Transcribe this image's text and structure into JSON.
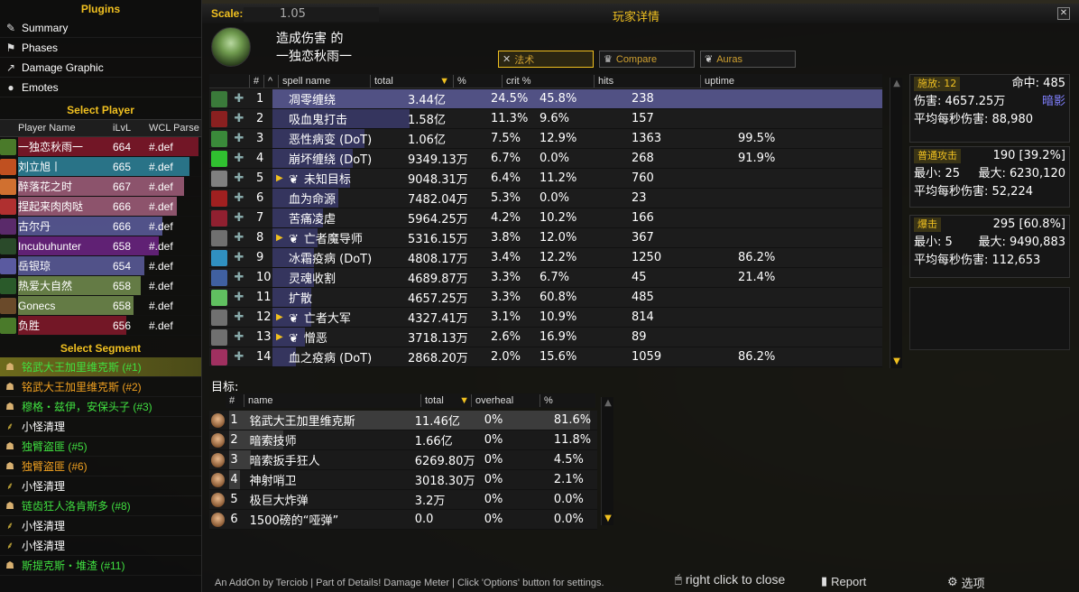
{
  "plugins": {
    "title": "Plugins",
    "items": [
      {
        "label": "Summary",
        "icon": "scroll-icon"
      },
      {
        "label": "Phases",
        "icon": "phases-icon"
      },
      {
        "label": "Damage Graphic",
        "icon": "graph-icon"
      },
      {
        "label": "Emotes",
        "icon": "chat-icon"
      }
    ]
  },
  "players": {
    "title": "Select Player",
    "columns": [
      "Player Name",
      "iLvL",
      "WCL Parse"
    ],
    "rows": [
      {
        "name": "一独恋秋雨一",
        "ilvl": "664",
        "wcl": "#.def",
        "color": "#c41e3a",
        "bar": 1.0,
        "icon": "#4a7a2a"
      },
      {
        "name": "刘立旭丨",
        "ilvl": "665",
        "wcl": "#.def",
        "color": "#3fc7eb",
        "bar": 0.95,
        "icon": "#c05020"
      },
      {
        "name": "醉落花之时",
        "ilvl": "667",
        "wcl": "#.def",
        "color": "#f48cba",
        "bar": 0.92,
        "icon": "#d07030"
      },
      {
        "name": "捏起来肉肉哒",
        "ilvl": "666",
        "wcl": "#.def",
        "color": "#f48cba",
        "bar": 0.88,
        "icon": "#b03030"
      },
      {
        "name": "古尔丹",
        "ilvl": "666",
        "wcl": "#.def",
        "color": "#8788ee",
        "bar": 0.8,
        "icon": "#5a2a6a"
      },
      {
        "name": "Incubuhunter",
        "ilvl": "658",
        "wcl": "#.def",
        "color": "#a330c9",
        "bar": 0.78,
        "icon": "#2a4a2a"
      },
      {
        "name": "岳银琼",
        "ilvl": "654",
        "wcl": "#.def",
        "color": "#8788ee",
        "bar": 0.7,
        "icon": "#5a5aa0"
      },
      {
        "name": "热爱大自然",
        "ilvl": "658",
        "wcl": "#.def",
        "color": "#aad372",
        "bar": 0.68,
        "icon": "#2a5a2a"
      },
      {
        "name": "Gonecs",
        "ilvl": "658",
        "wcl": "#.def",
        "color": "#aad372",
        "bar": 0.64,
        "icon": "#6a4a2a"
      },
      {
        "name": "负胜",
        "ilvl": "656",
        "wcl": "#.def",
        "color": "#c41e3a",
        "bar": 0.6,
        "icon": "#4a7a2a"
      }
    ]
  },
  "segments": {
    "title": "Select Segment",
    "items": [
      {
        "label": "铭武大王加里维克斯 (#1)",
        "color": "#40e040",
        "selected": true,
        "icon": "skull"
      },
      {
        "label": "铭武大王加里维克斯 (#2)",
        "color": "#f0a020",
        "selected": false,
        "icon": "skull"
      },
      {
        "label": "穆格・兹伊，安保头子 (#3)",
        "color": "#40e040",
        "selected": false,
        "icon": "skull"
      },
      {
        "label": "小怪清理",
        "color": "#ffffff",
        "selected": false,
        "icon": "broom"
      },
      {
        "label": "独臂盗匪 (#5)",
        "color": "#40e040",
        "selected": false,
        "icon": "skull"
      },
      {
        "label": "独臂盗匪 (#6)",
        "color": "#f0a020",
        "selected": false,
        "icon": "skull"
      },
      {
        "label": "小怪清理",
        "color": "#ffffff",
        "selected": false,
        "icon": "broom"
      },
      {
        "label": "链齿狂人洛肯斯多 (#8)",
        "color": "#40e040",
        "selected": false,
        "icon": "skull"
      },
      {
        "label": "小怪清理",
        "color": "#ffffff",
        "selected": false,
        "icon": "broom"
      },
      {
        "label": "小怪清理",
        "color": "#ffffff",
        "selected": false,
        "icon": "broom"
      },
      {
        "label": "斯提克斯・堆渣 (#11)",
        "color": "#40e040",
        "selected": false,
        "icon": "skull"
      }
    ]
  },
  "window": {
    "scale_label": "Scale:",
    "scale_value": "1.05",
    "title": "玩家详情",
    "close": "✕"
  },
  "header": {
    "line1": "造成伤害 的",
    "line2": "一独恋秋雨一"
  },
  "tabs": [
    {
      "label": "法术",
      "icon": "sword-icon",
      "active": true
    },
    {
      "label": "Compare",
      "icon": "crown-icon",
      "active": false
    },
    {
      "label": "Auras",
      "icon": "paw-icon",
      "active": false
    }
  ],
  "spells": {
    "columns": [
      "#",
      "^",
      "spell name",
      "total",
      "%",
      "crit %",
      "hits",
      "uptime"
    ],
    "rows": [
      {
        "idx": "1",
        "name": "凋零缠绕",
        "total": "3.44亿",
        "pct": "24.5%",
        "crit": "45.8%",
        "hits": "238",
        "uptime": "",
        "bar": 1.0,
        "pet": false,
        "icon": "#3a7a3a"
      },
      {
        "idx": "2",
        "name": "吸血鬼打击",
        "total": "1.58亿",
        "pct": "11.3%",
        "crit": "9.6%",
        "hits": "157",
        "uptime": "",
        "bar": 0.46,
        "pet": false,
        "icon": "#8a2020"
      },
      {
        "idx": "3",
        "name": "恶性病变 (DoT)",
        "total": "1.06亿",
        "pct": "7.5%",
        "crit": "12.9%",
        "hits": "1363",
        "uptime": "99.5%",
        "bar": 0.31,
        "pet": false,
        "icon": "#3a8a3a"
      },
      {
        "idx": "4",
        "name": "崩坏缠绕 (DoT)",
        "total": "9349.13万",
        "pct": "6.7%",
        "crit": "0.0%",
        "hits": "268",
        "uptime": "91.9%",
        "bar": 0.27,
        "pet": false,
        "icon": "#30c030"
      },
      {
        "idx": "5",
        "name": "未知目标",
        "total": "9048.31万",
        "pct": "6.4%",
        "crit": "11.2%",
        "hits": "760",
        "uptime": "",
        "bar": 0.26,
        "pet": true,
        "icon": "#808080"
      },
      {
        "idx": "6",
        "name": "血为命源",
        "total": "7482.04万",
        "pct": "5.3%",
        "crit": "0.0%",
        "hits": "23",
        "uptime": "",
        "bar": 0.22,
        "pet": false,
        "icon": "#a02020"
      },
      {
        "idx": "7",
        "name": "苦痛凌虐",
        "total": "5964.25万",
        "pct": "4.2%",
        "crit": "10.2%",
        "hits": "166",
        "uptime": "",
        "bar": 0.17,
        "pet": false,
        "icon": "#902030"
      },
      {
        "idx": "8",
        "name": "亡者魔导师",
        "total": "5316.15万",
        "pct": "3.8%",
        "crit": "12.0%",
        "hits": "367",
        "uptime": "",
        "bar": 0.15,
        "pet": true,
        "icon": "#707070"
      },
      {
        "idx": "9",
        "name": "冰霜疫病 (DoT)",
        "total": "4808.17万",
        "pct": "3.4%",
        "crit": "12.2%",
        "hits": "1250",
        "uptime": "86.2%",
        "bar": 0.14,
        "pet": false,
        "icon": "#3090c0"
      },
      {
        "idx": "10",
        "name": "灵魂收割",
        "total": "4689.87万",
        "pct": "3.3%",
        "crit": "6.7%",
        "hits": "45",
        "uptime": "21.4%",
        "bar": 0.14,
        "pet": false,
        "icon": "#4060a0"
      },
      {
        "idx": "11",
        "name": "扩散",
        "total": "4657.25万",
        "pct": "3.3%",
        "crit": "60.8%",
        "hits": "485",
        "uptime": "",
        "bar": 0.13,
        "pet": false,
        "icon": "#60c060"
      },
      {
        "idx": "12",
        "name": "亡者大军",
        "total": "4327.41万",
        "pct": "3.1%",
        "crit": "10.9%",
        "hits": "814",
        "uptime": "",
        "bar": 0.13,
        "pet": true,
        "icon": "#707070"
      },
      {
        "idx": "13",
        "name": "憎恶",
        "total": "3718.13万",
        "pct": "2.6%",
        "crit": "16.9%",
        "hits": "89",
        "uptime": "",
        "bar": 0.11,
        "pet": true,
        "icon": "#707070"
      },
      {
        "idx": "14",
        "name": "血之疫病 (DoT)",
        "total": "2868.20万",
        "pct": "2.0%",
        "crit": "15.6%",
        "hits": "1059",
        "uptime": "86.2%",
        "bar": 0.08,
        "pet": false,
        "icon": "#a03060"
      }
    ]
  },
  "targets": {
    "label": "目标:",
    "columns": [
      "#",
      "name",
      "total",
      "overheal",
      "%"
    ],
    "rows": [
      {
        "idx": "1",
        "name": "铭武大王加里维克斯",
        "total": "11.46亿",
        "overheal": "0%",
        "pct": "81.6%",
        "bar": 1.0
      },
      {
        "idx": "2",
        "name": "暗索技师",
        "total": "1.66亿",
        "overheal": "0%",
        "pct": "11.8%",
        "bar": 0.15
      },
      {
        "idx": "3",
        "name": "暗索扳手狂人",
        "total": "6269.80万",
        "overheal": "0%",
        "pct": "4.5%",
        "bar": 0.06
      },
      {
        "idx": "4",
        "name": "神射哨卫",
        "total": "3018.30万",
        "overheal": "0%",
        "pct": "2.1%",
        "bar": 0.03
      },
      {
        "idx": "5",
        "name": "极巨大炸弹",
        "total": "3.2万",
        "overheal": "0%",
        "pct": "0.0%",
        "bar": 0.0
      },
      {
        "idx": "6",
        "name": "1500磅的“哑弹”",
        "total": "0.0",
        "overheal": "0%",
        "pct": "0.0%",
        "bar": 0.0
      }
    ]
  },
  "summary": {
    "cast_label": "施放: 12",
    "hit_label": "命中: 485",
    "damage_line": "伤害: 4657.25万",
    "school": "暗影",
    "school_color": "#8080ff",
    "avg_line": "平均每秒伤害: 88,980",
    "normal_title": "普通攻击",
    "normal_count": "190 [39.2%]",
    "normal_min": "最小: 25",
    "normal_max": "最大: 6230,120",
    "normal_avg": "平均每秒伤害: 52,224",
    "crit_title": "爆击",
    "crit_count": "295 [60.8%]",
    "crit_min": "最小: 5",
    "crit_max": "最大: 9490,883",
    "crit_avg": "平均每秒伤害: 112,653"
  },
  "footer": {
    "note": "An AddOn by Terciob | Part of Details! Damage Meter | Click 'Options' button for settings.",
    "close_hint": "right click to close",
    "report": "Report",
    "options": "选项"
  },
  "colors": {
    "accent": "#f0c020",
    "spell_bar": "#3a3a6a",
    "spell_bar_selected": "#5b5b96"
  }
}
